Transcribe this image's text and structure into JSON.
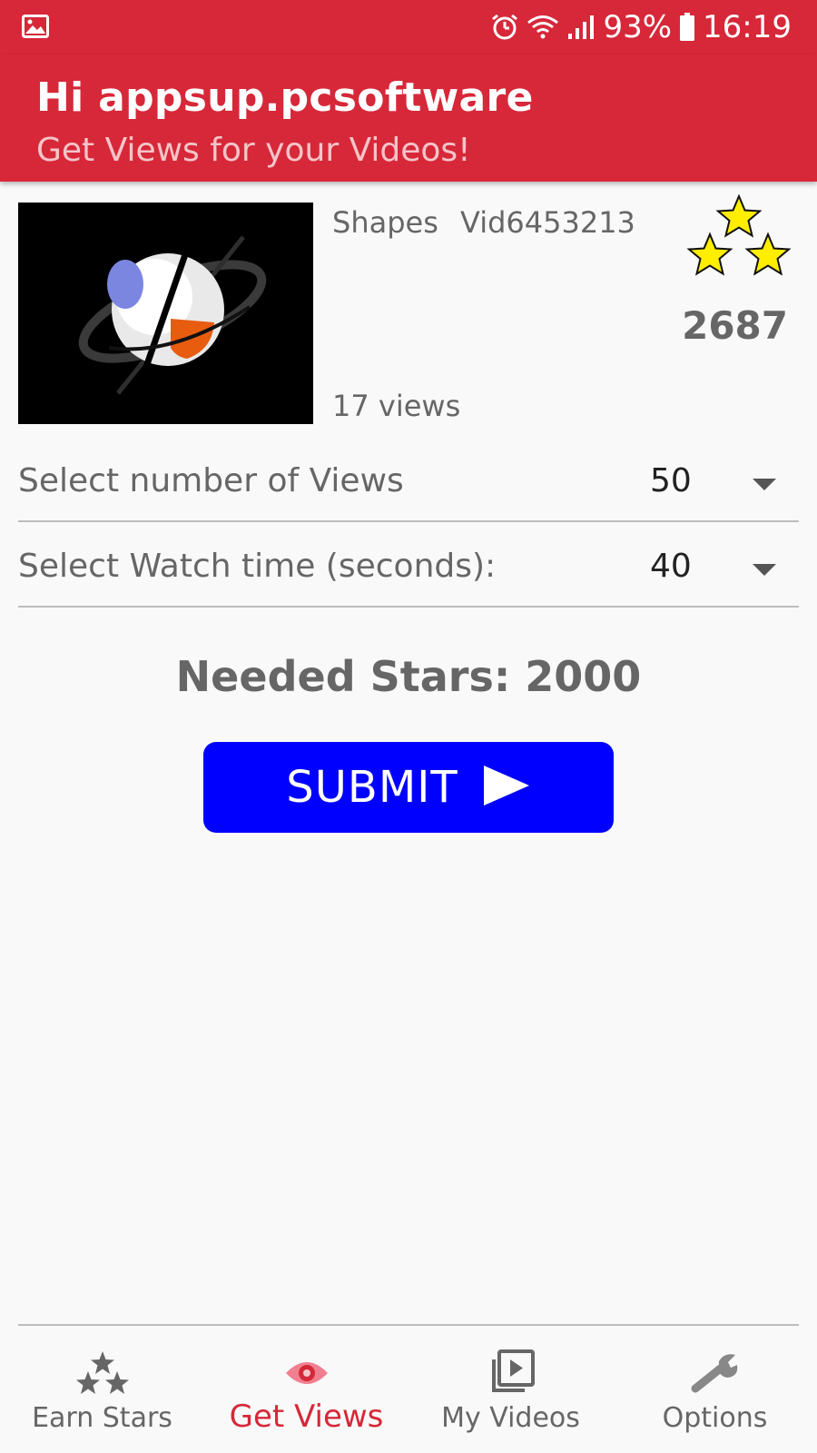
{
  "status_bar": {
    "left_icon": "gallery-icon",
    "icons": [
      "alarm-icon",
      "wifi-icon",
      "signal-icon"
    ],
    "battery_percent": "93%",
    "battery_icon": "battery-icon",
    "time": "16:19"
  },
  "header": {
    "greeting": "Hi appsup.pcsoftware",
    "subtitle": "Get Views for your Videos!",
    "background_color": "#d62839"
  },
  "video": {
    "name": "Shapes",
    "id": "Vid6453213",
    "views": "17 views",
    "thumbnail_icon": "shapes-logo"
  },
  "stars_balance": {
    "icon": "three-stars-icon",
    "count": "2687"
  },
  "form": {
    "views_label": "Select number of Views",
    "views_value": "50",
    "watch_time_label": "Select Watch time (seconds):",
    "watch_time_value": "40"
  },
  "needed_stars": "Needed Stars: 2000",
  "submit": {
    "label": "SUBMIT",
    "icon": "play-arrow-icon",
    "color": "#0000ff"
  },
  "bottom_nav": {
    "items": [
      {
        "label": "Earn Stars",
        "icon": "stars-icon",
        "active": false
      },
      {
        "label": "Get Views",
        "icon": "eye-icon",
        "active": true
      },
      {
        "label": "My Videos",
        "icon": "video-library-icon",
        "active": false
      },
      {
        "label": "Options",
        "icon": "wrench-icon",
        "active": false
      }
    ],
    "active_color": "#d62839"
  }
}
